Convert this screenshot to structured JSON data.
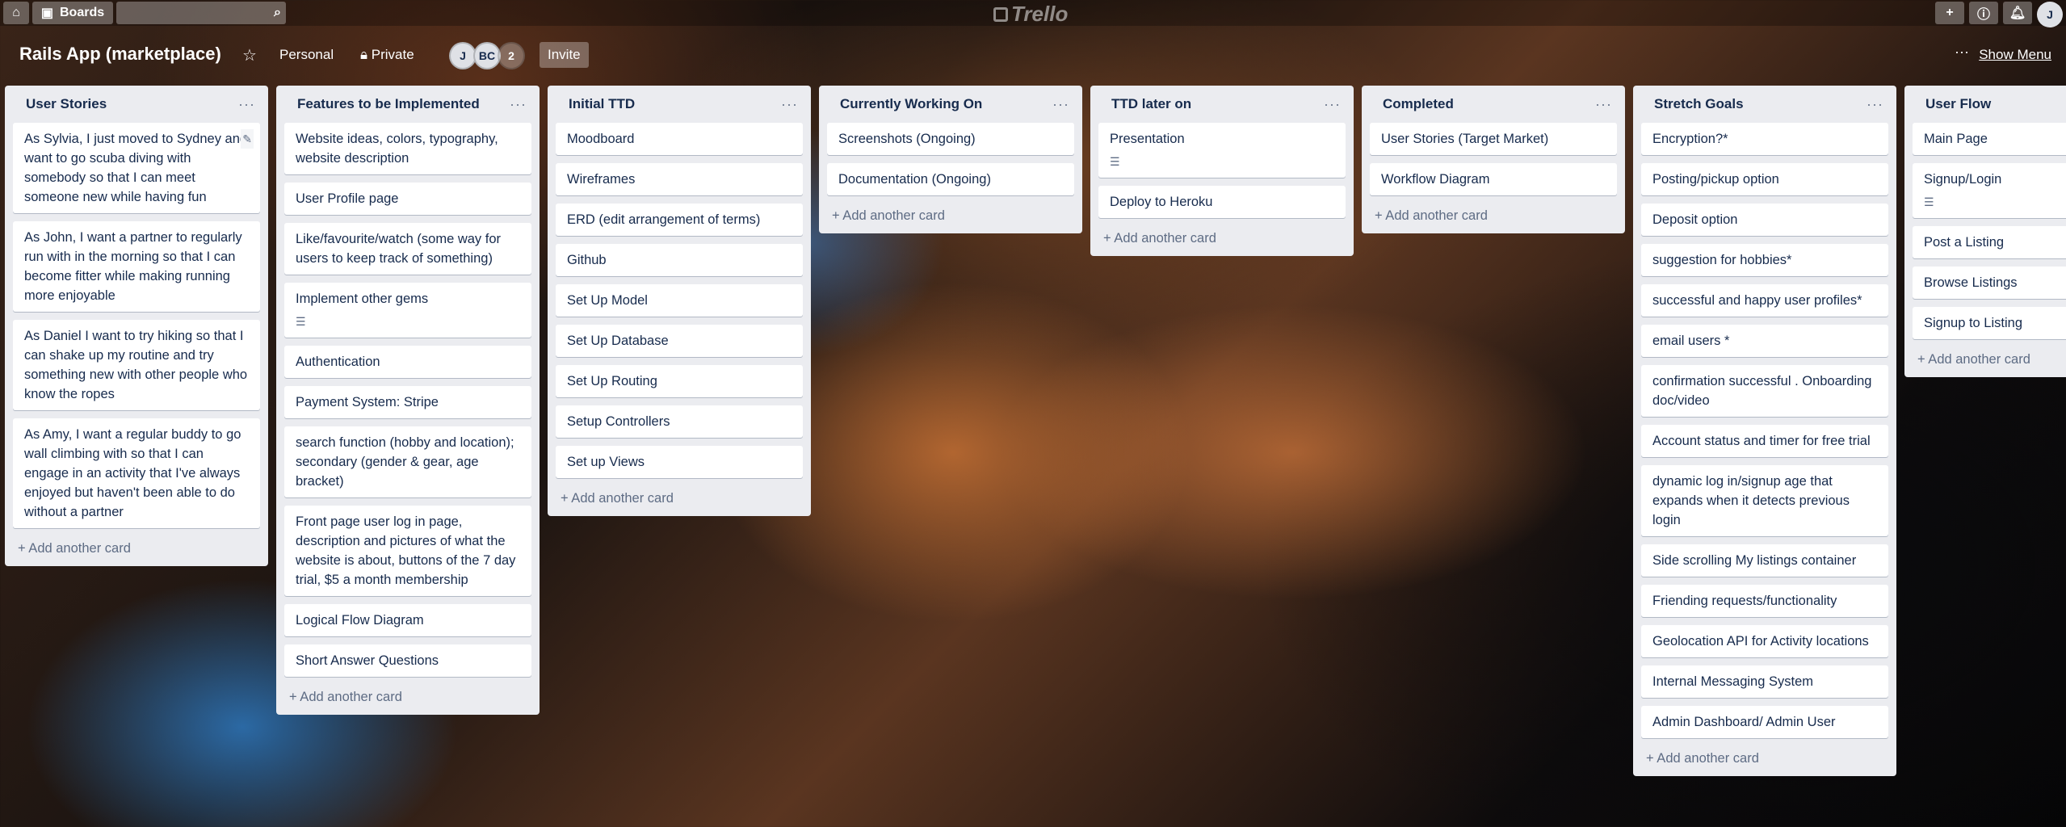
{
  "topbar": {
    "boards_label": "Boards",
    "logo_text": "Trello",
    "avatar_initial": "J"
  },
  "board": {
    "title": "Rails App (marketplace)",
    "team_label": "Personal",
    "visibility_label": "Private",
    "members": [
      "J",
      "BC"
    ],
    "member_count": "2",
    "invite_label": "Invite",
    "show_menu_label": "Show Menu"
  },
  "add_card_label": "+ Add another card",
  "lists": [
    {
      "title": "User Stories",
      "cards": [
        "As Sylvia, I just moved to Sydney and want to go scuba diving with somebody so that I can meet someone new while having fun",
        "As John, I want a partner to regularly run with in the morning so that I can become fitter while making running more enjoyable",
        "As Daniel I want to try hiking so that I can shake up my routine and try something new with other people who know the ropes",
        "As Amy, I want a regular buddy to go wall climbing with so that I can engage in an activity that I've always enjoyed but haven't been able to do without a partner"
      ]
    },
    {
      "title": "Features to be Implemented",
      "cards": [
        "Website ideas, colors, typography, website description",
        "User Profile page",
        "Like/favourite/watch (some way for users to keep track of something)",
        "Implement other gems",
        "Authentication",
        "Payment System: Stripe",
        "search function (hobby and location); secondary (gender & gear, age bracket)",
        "Front page user log in page, description and pictures of what the website is about, buttons of the 7 day trial, $5 a month membership",
        "Logical Flow Diagram",
        "Short Answer Questions"
      ]
    },
    {
      "title": "Initial TTD",
      "cards": [
        "Moodboard",
        "Wireframes",
        "ERD (edit arrangement of terms)",
        "Github",
        "Set Up Model",
        "Set Up Database",
        "Set Up Routing",
        "Setup Controllers",
        "Set up Views"
      ]
    },
    {
      "title": "Currently Working On",
      "cards": [
        "Screenshots (Ongoing)",
        "Documentation (Ongoing)"
      ]
    },
    {
      "title": "TTD later on",
      "cards": [
        "Presentation",
        "Deploy to Heroku"
      ]
    },
    {
      "title": "Completed",
      "cards": [
        "User Stories (Target Market)",
        "Workflow Diagram"
      ]
    },
    {
      "title": "Stretch Goals",
      "cards": [
        "Encryption?*",
        "Posting/pickup option",
        "Deposit option",
        "suggestion for hobbies*",
        "successful and happy user profiles*",
        "email users *",
        "confirmation successful . Onboarding doc/video",
        "Account status and timer for free trial",
        "dynamic log in/signup age that expands when it detects previous login",
        "Side scrolling My listings container",
        "Friending requests/functionality",
        "Geolocation API for Activity locations",
        "Internal Messaging System",
        "Admin Dashboard/ Admin User"
      ]
    },
    {
      "title": "User Flow",
      "cards": [
        "Main Page",
        "Signup/Login",
        "Post a Listing",
        "Browse Listings",
        "Signup to Listing"
      ]
    }
  ]
}
